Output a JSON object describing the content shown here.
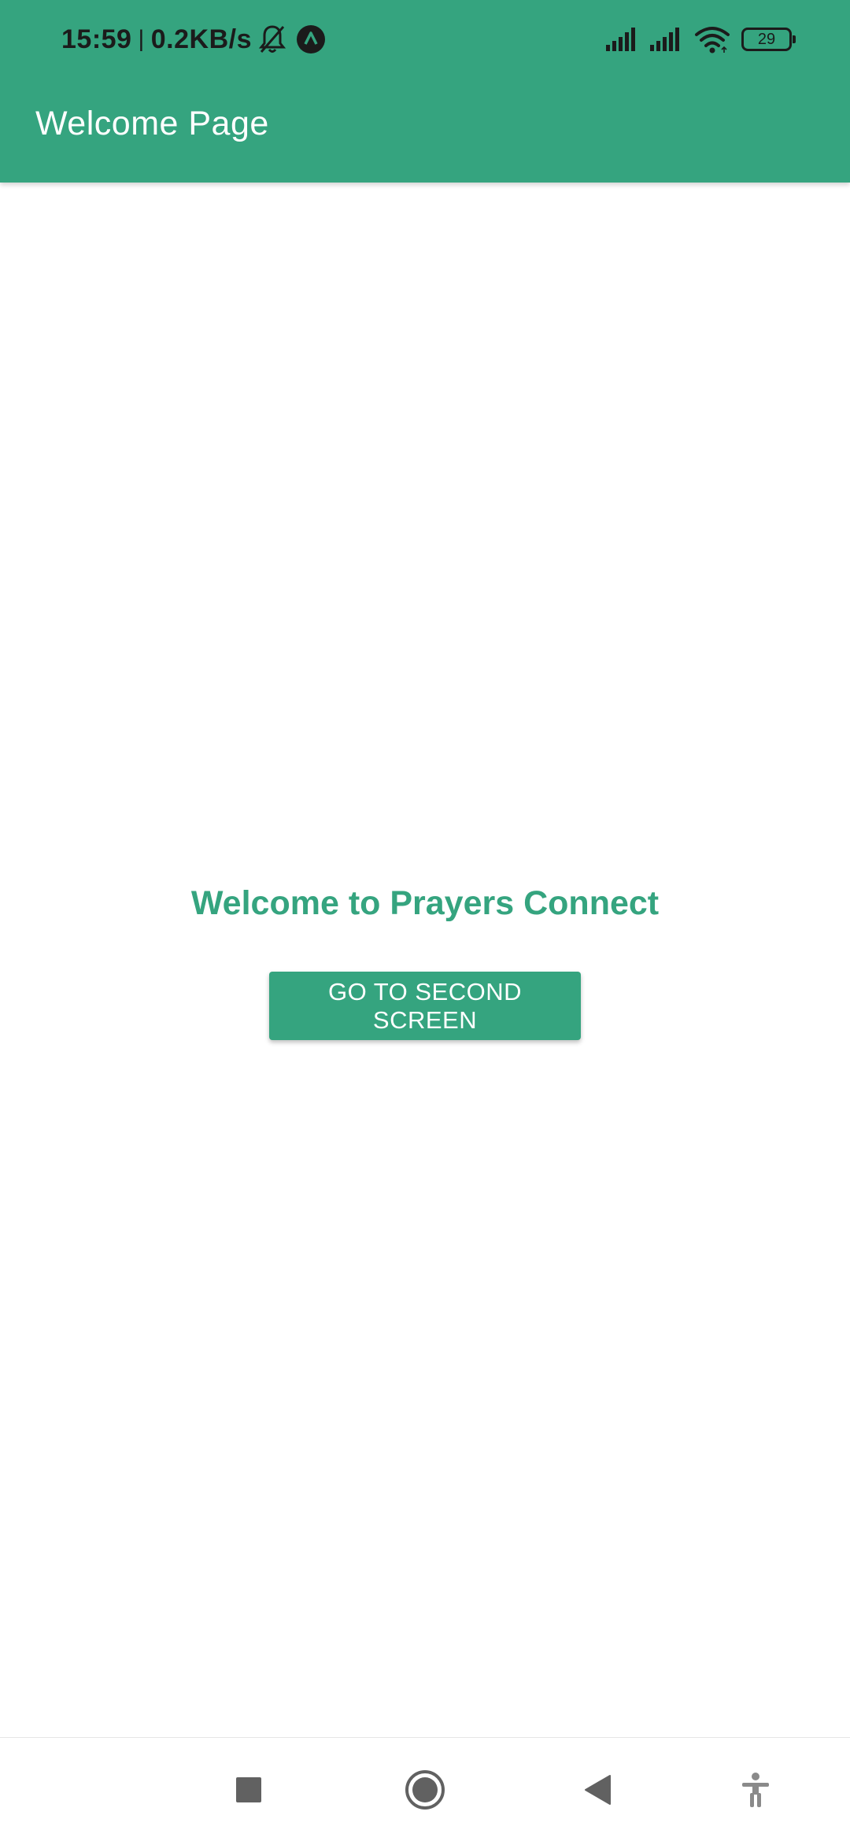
{
  "status_bar": {
    "time": "15:59",
    "separator": "|",
    "network_speed": "0.2KB/s",
    "left_icons": [
      "bell-muted-icon",
      "circle-a-icon"
    ],
    "right_icons": [
      "signal-icon",
      "signal-icon",
      "wifi-icon",
      "battery-icon"
    ],
    "battery_level": "29"
  },
  "app_bar": {
    "title": "Welcome Page"
  },
  "main": {
    "welcome_text": "Welcome to Prayers Connect",
    "button_label": "GO TO SECOND SCREEN"
  },
  "navigation_bar": {
    "buttons": [
      "recents-square-icon",
      "home-circle-icon",
      "back-triangle-icon",
      "accessibility-icon"
    ]
  },
  "colors": {
    "primary": "#35a47f",
    "status_text": "#1b1b1b",
    "nav_icons": "#616161",
    "background": "#ffffff"
  }
}
